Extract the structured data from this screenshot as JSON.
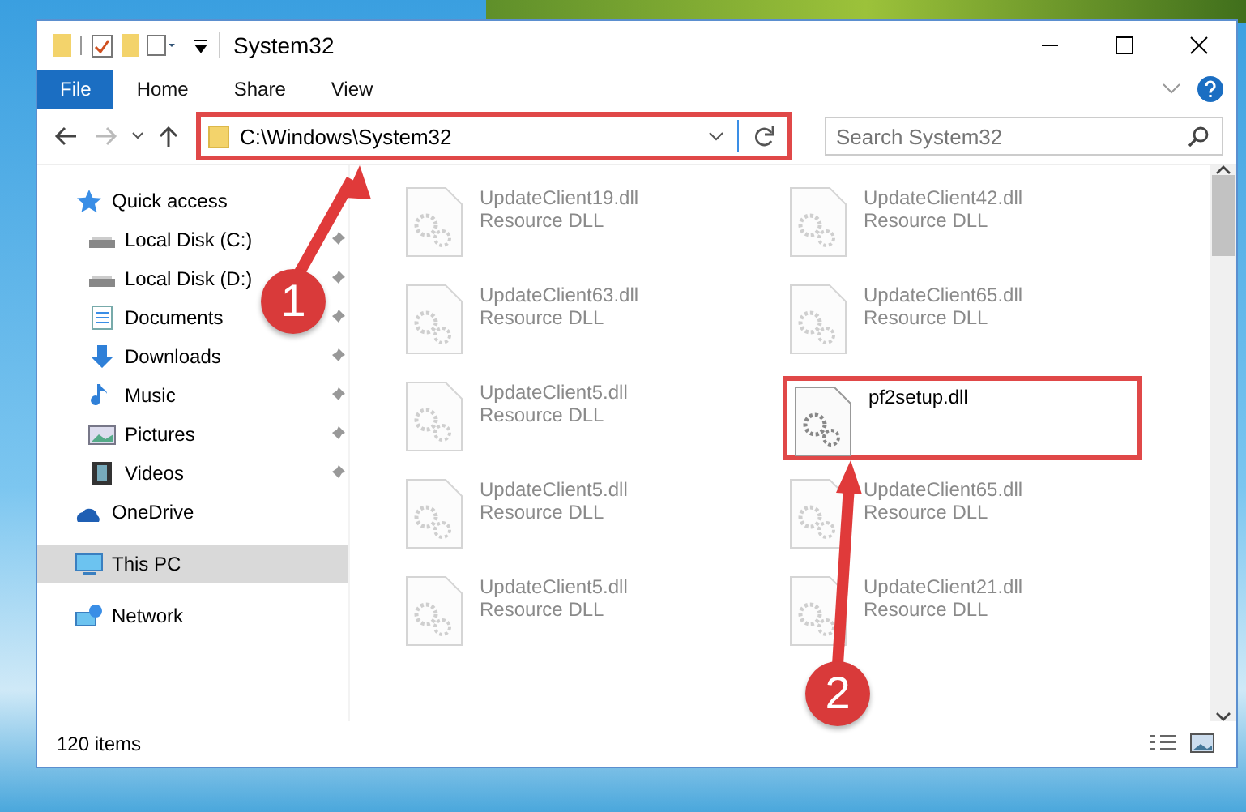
{
  "window": {
    "title": "System32"
  },
  "ribbon": {
    "tabs": [
      {
        "label": "File",
        "selected": true
      },
      {
        "label": "Home",
        "selected": false
      },
      {
        "label": "Share",
        "selected": false
      },
      {
        "label": "View",
        "selected": false
      }
    ]
  },
  "address": {
    "path": "C:\\Windows\\System32",
    "highlighted": true
  },
  "search": {
    "placeholder": "Search System32"
  },
  "sidebar": {
    "items": [
      {
        "label": "Quick access",
        "kind": "star",
        "selected": false,
        "children": [
          {
            "label": "Local Disk (C:)",
            "kind": "drive",
            "pinned": true
          },
          {
            "label": "Local Disk (D:)",
            "kind": "drive",
            "pinned": true
          },
          {
            "label": "Documents",
            "kind": "documents",
            "pinned": true
          },
          {
            "label": "Downloads",
            "kind": "downloads",
            "pinned": true
          },
          {
            "label": "Music",
            "kind": "music",
            "pinned": true
          },
          {
            "label": "Pictures",
            "kind": "pictures",
            "pinned": true
          },
          {
            "label": "Videos",
            "kind": "videos",
            "pinned": true
          }
        ]
      },
      {
        "label": "OneDrive",
        "kind": "cloud",
        "selected": false
      },
      {
        "label": "This PC",
        "kind": "pc",
        "selected": true
      },
      {
        "label": "Network",
        "kind": "network",
        "selected": false
      }
    ]
  },
  "files": [
    {
      "name": "UpdateClient19.dll",
      "type": "Resource DLL",
      "dimmed": true,
      "highlighted": false
    },
    {
      "name": "UpdateClient42.dll",
      "type": "Resource DLL",
      "dimmed": true,
      "highlighted": false
    },
    {
      "name": "UpdateClient63.dll",
      "type": "Resource DLL",
      "dimmed": true,
      "highlighted": false
    },
    {
      "name": "UpdateClient65.dll",
      "type": "Resource DLL",
      "dimmed": true,
      "highlighted": false
    },
    {
      "name": "UpdateClient5.dll",
      "type": "Resource DLL",
      "dimmed": true,
      "highlighted": false
    },
    {
      "name": "pf2setup.dll",
      "dimmed": false,
      "highlighted": true
    },
    {
      "name": "UpdateClient5.dll",
      "type": "Resource DLL",
      "dimmed": true,
      "highlighted": false
    },
    {
      "name": "UpdateClient65.dll",
      "type": "Resource DLL",
      "dimmed": true,
      "highlighted": false
    },
    {
      "name": "UpdateClient5.dll",
      "type": "Resource DLL",
      "dimmed": true,
      "highlighted": false
    },
    {
      "name": "UpdateClient21.dll",
      "type": "Resource DLL",
      "dimmed": true,
      "highlighted": false
    }
  ],
  "status_bar": {
    "count": "120 items"
  },
  "annotations": [
    {
      "number": "1"
    },
    {
      "number": "2"
    }
  ]
}
